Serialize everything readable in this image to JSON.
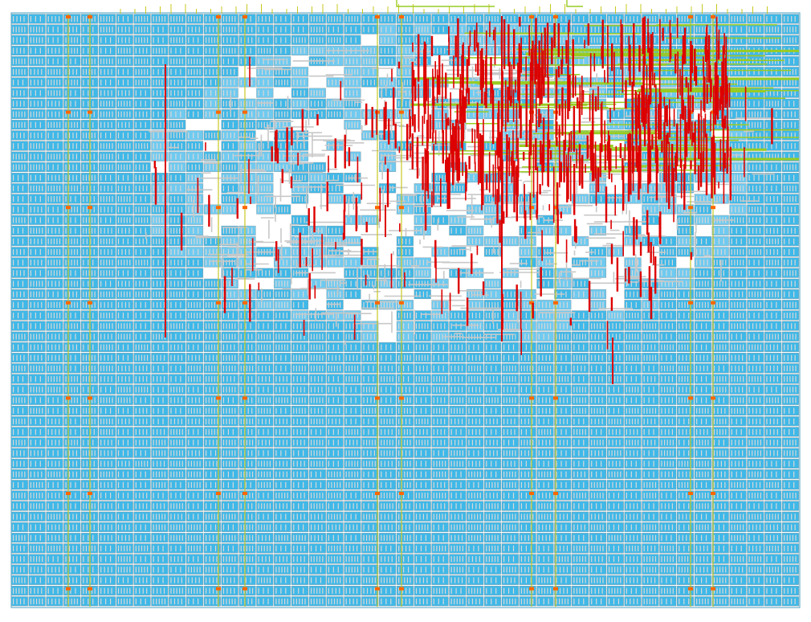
{
  "layout": {
    "colors": {
      "background": "#ffffff",
      "cell_fill": "#3fb8e8",
      "cell_fill_light": "#6fcaf0",
      "cell_outline": "#8aa0a8",
      "cell_pin": "#d8d8d8",
      "metal_route_light": "#c8c8c8",
      "metal_route_vertical": "#dd0000",
      "metal_route_horizontal": "#99cc22",
      "power_stripe": "#c8c820",
      "io_pin": "#c8c820"
    },
    "core_rows": 56,
    "cells_per_row": 45,
    "top_pin_count": 26,
    "power_stripe_count": 10,
    "congestion_region": "upper-middle",
    "dense_route_region": "upper-right"
  }
}
